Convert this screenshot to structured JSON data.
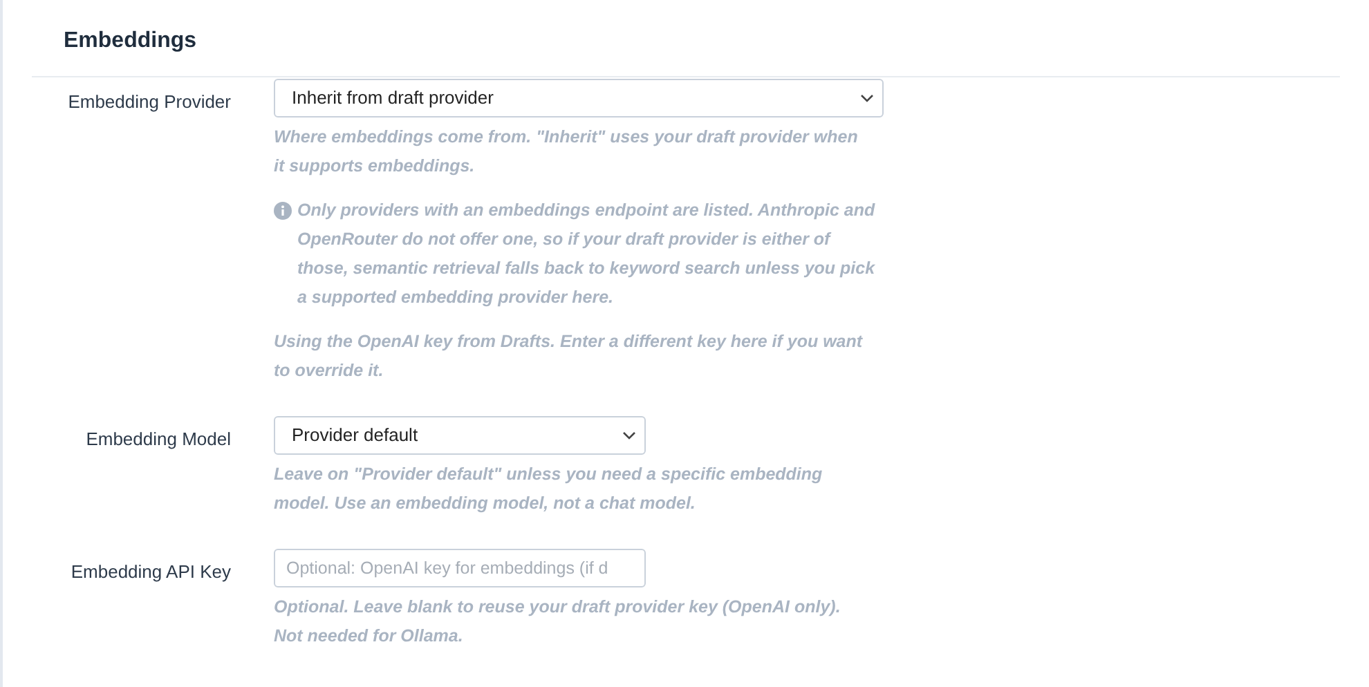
{
  "section": {
    "title": "Embeddings"
  },
  "fields": [
    {
      "kind": "select",
      "label": "Embedding Provider",
      "value": "Inherit from draft provider",
      "wide": true,
      "notes": [
        {
          "kind": "plain",
          "text": "Where embeddings come from. \"Inherit\" uses your draft provider when it supports embeddings."
        },
        {
          "kind": "info",
          "text": "Only providers with an embeddings endpoint are listed. Anthropic and OpenRouter do not offer one, so if your draft provider is either of those, semantic retrieval falls back to keyword search unless you pick a supported embedding provider here."
        },
        {
          "kind": "plain",
          "text": "Using the OpenAI key from Drafts. Enter a different key here if you want to override it."
        }
      ]
    },
    {
      "kind": "select",
      "label": "Embedding Model",
      "value": "Provider default",
      "wide": false,
      "notes": [
        {
          "kind": "plain",
          "text": "Leave on \"Provider default\" unless you need a specific embedding model. Use an embedding model, not a chat model."
        }
      ]
    },
    {
      "kind": "text",
      "label": "Embedding API Key",
      "placeholder": "Optional: OpenAI key for embeddings (if d",
      "wide": false,
      "notes": [
        {
          "kind": "plain",
          "text": "Optional. Leave blank to reuse your draft provider key (OpenAI only). Not needed for Ollama."
        }
      ]
    }
  ]
}
